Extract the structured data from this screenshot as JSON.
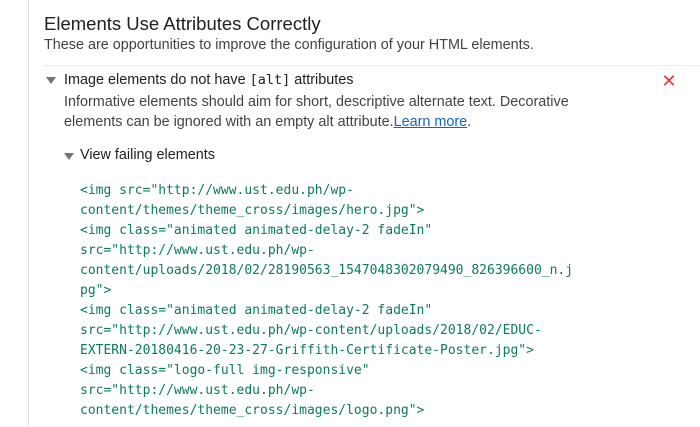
{
  "section": {
    "title": "Elements Use Attributes Correctly",
    "description": "These are opportunities to improve the configuration of your HTML elements."
  },
  "audit": {
    "title_prefix": "Image elements do not have ",
    "title_code": "[alt]",
    "title_suffix": " attributes",
    "status_icon": "fail-x-icon",
    "status_color": "#e53935",
    "description": "Informative elements should aim for short, descriptive alternate text. Decorative elements can be ignored with an empty alt attribute.",
    "learn_more_label": "Learn more",
    "learn_more_trailing": "."
  },
  "details": {
    "summary": "View failing elements",
    "code_lines": [
      "<img src=\"http://www.ust.edu.ph/wp-",
      "content/themes/theme_cross/images/hero.jpg\">",
      "<img class=\"animated animated-delay-2 fadeIn\"",
      "src=\"http://www.ust.edu.ph/wp-",
      "content/uploads/2018/02/28190563_1547048302079490_826396600_n.j",
      "pg\">",
      "<img class=\"animated animated-delay-2 fadeIn\"",
      "src=\"http://www.ust.edu.ph/wp-content/uploads/2018/02/EDUC-",
      "EXTERN-20180416-20-23-27-Griffith-Certificate-Poster.jpg\">",
      "<img class=\"logo-full img-responsive\"",
      "src=\"http://www.ust.edu.ph/wp-",
      "content/themes/theme_cross/images/logo.png\">"
    ]
  },
  "colors": {
    "code": "#0b7a5f",
    "link": "#1565c0",
    "fail": "#e53935"
  }
}
